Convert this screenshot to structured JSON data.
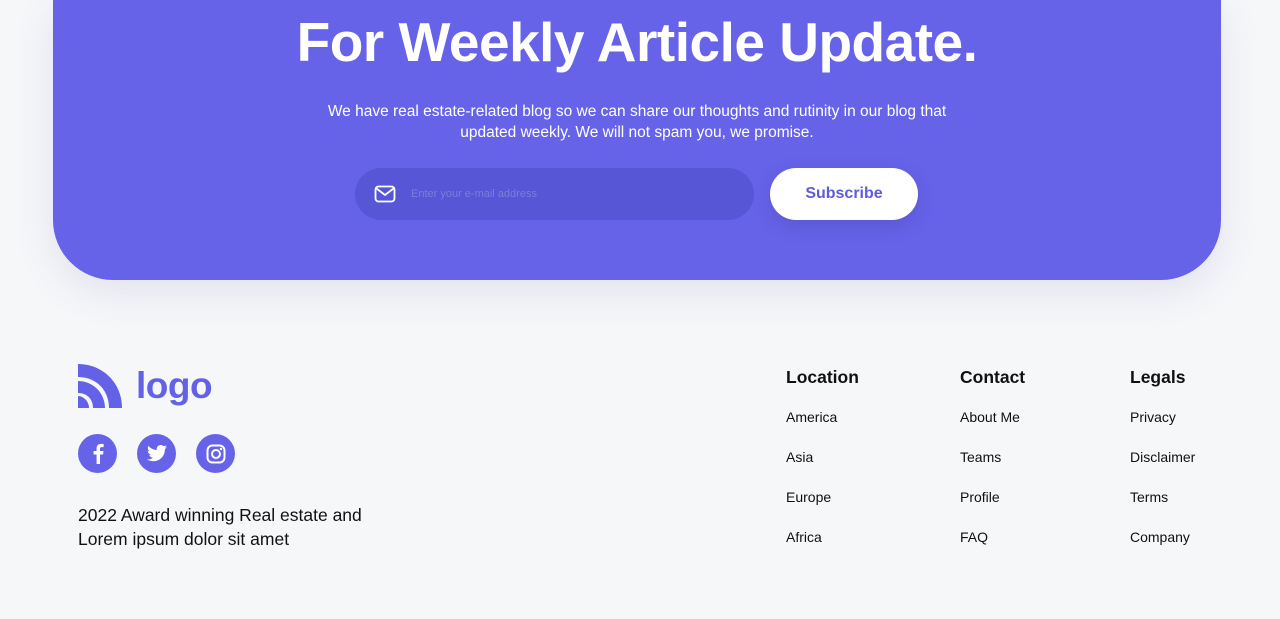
{
  "newsletter": {
    "title": "For Weekly Article Update.",
    "description": "We have real estate-related blog so we can share our thoughts and rutinity in our blog that updated weekly. We will not spam you, we promise.",
    "email_placeholder": "Enter your e-mail address",
    "email_value": "",
    "subscribe_label": "Subscribe",
    "mail_icon": "mail-icon"
  },
  "footer": {
    "logo_text": "logo",
    "socials": [
      {
        "icon": "facebook-icon"
      },
      {
        "icon": "twitter-icon"
      },
      {
        "icon": "instagram-icon"
      }
    ],
    "tagline": "2022 Award winning Real estate and Lorem ipsum dolor sit amet",
    "columns": [
      {
        "title": "Location",
        "links": [
          "America",
          "Asia",
          "Europe",
          "Africa"
        ]
      },
      {
        "title": "Contact",
        "links": [
          "About Me",
          "Teams",
          "Profile",
          "FAQ"
        ]
      },
      {
        "title": "Legals",
        "links": [
          "Privacy",
          "Disclaimer",
          "Terms",
          "Company"
        ]
      }
    ]
  },
  "colors": {
    "brand": "#6663e8",
    "input_bg": "#5656d6",
    "page_bg": "#f6f7f9",
    "text": "#111111",
    "white": "#ffffff"
  }
}
